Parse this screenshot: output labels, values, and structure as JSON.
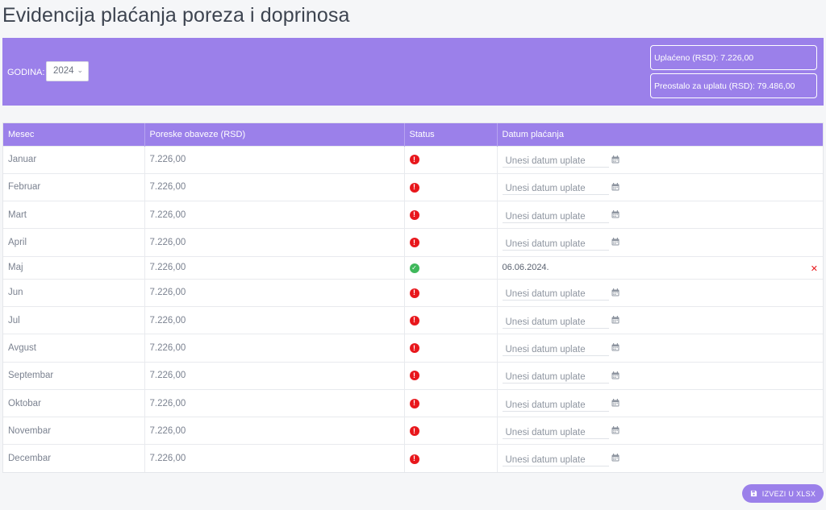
{
  "page": {
    "title": "Evidencija plaćanja poreza i doprinosa"
  },
  "filter": {
    "year_label": "GODINA:",
    "year_value": "2024",
    "paid_summary": "Uplaćeno (RSD): 7.226,00",
    "remaining_summary": "Preostalo za uplatu (RSD): 79.486,00"
  },
  "table": {
    "headers": [
      "Mesec",
      "Poreske obaveze (RSD)",
      "Status",
      "Datum plaćanja"
    ],
    "date_placeholder": "Unesi datum uplate",
    "rows": [
      {
        "month": "Januar",
        "amount": "7.226,00",
        "status": "unpaid",
        "date": ""
      },
      {
        "month": "Februar",
        "amount": "7.226,00",
        "status": "unpaid",
        "date": ""
      },
      {
        "month": "Mart",
        "amount": "7.226,00",
        "status": "unpaid",
        "date": ""
      },
      {
        "month": "April",
        "amount": "7.226,00",
        "status": "unpaid",
        "date": ""
      },
      {
        "month": "Maj",
        "amount": "7.226,00",
        "status": "paid",
        "date": "06.06.2024."
      },
      {
        "month": "Jun",
        "amount": "7.226,00",
        "status": "unpaid",
        "date": ""
      },
      {
        "month": "Jul",
        "amount": "7.226,00",
        "status": "unpaid",
        "date": ""
      },
      {
        "month": "Avgust",
        "amount": "7.226,00",
        "status": "unpaid",
        "date": ""
      },
      {
        "month": "Septembar",
        "amount": "7.226,00",
        "status": "unpaid",
        "date": ""
      },
      {
        "month": "Oktobar",
        "amount": "7.226,00",
        "status": "unpaid",
        "date": ""
      },
      {
        "month": "Novembar",
        "amount": "7.226,00",
        "status": "unpaid",
        "date": ""
      },
      {
        "month": "Decembar",
        "amount": "7.226,00",
        "status": "unpaid",
        "date": ""
      }
    ]
  },
  "icons": {
    "unpaid": "exclamation-circle-icon",
    "paid": "check-circle-icon",
    "calendar": "calendar-icon",
    "clear": "close-icon",
    "export": "save-icon"
  },
  "colors": {
    "accent": "#9b80ea",
    "unpaid": "#e8171c",
    "paid": "#3fb85b"
  },
  "actions": {
    "export_label": "IZVEZI U XLSX"
  }
}
